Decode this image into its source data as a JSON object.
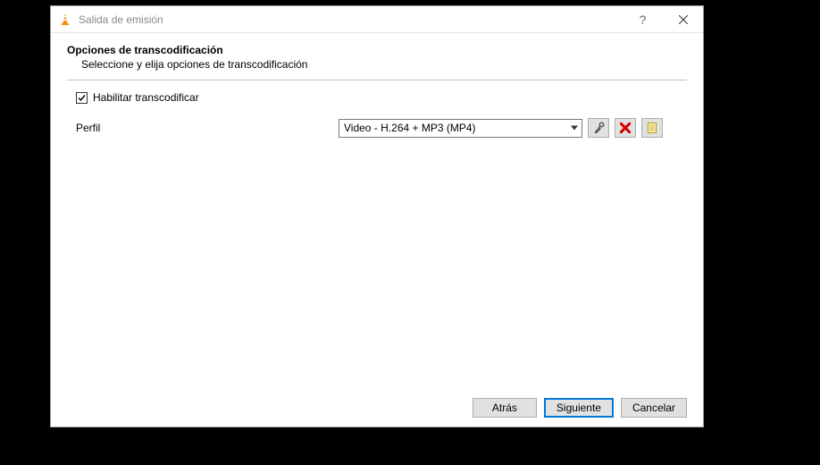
{
  "window": {
    "title": "Salida de emisión"
  },
  "page": {
    "heading": "Opciones de transcodificación",
    "subheading": "Seleccione y elija opciones de transcodificación"
  },
  "form": {
    "enable_transcode_label": "Habilitar transcodificar",
    "enable_transcode_checked": true,
    "profile_label": "Perfil",
    "profile_value": "Video - H.264 + MP3 (MP4)"
  },
  "icons": {
    "edit_tooltip": "Editar perfil seleccionado",
    "delete_tooltip": "Borrar perfil seleccionado",
    "new_tooltip": "Crear un perfil nuevo"
  },
  "buttons": {
    "back": "Atrás",
    "next": "Siguiente",
    "cancel": "Cancelar"
  }
}
